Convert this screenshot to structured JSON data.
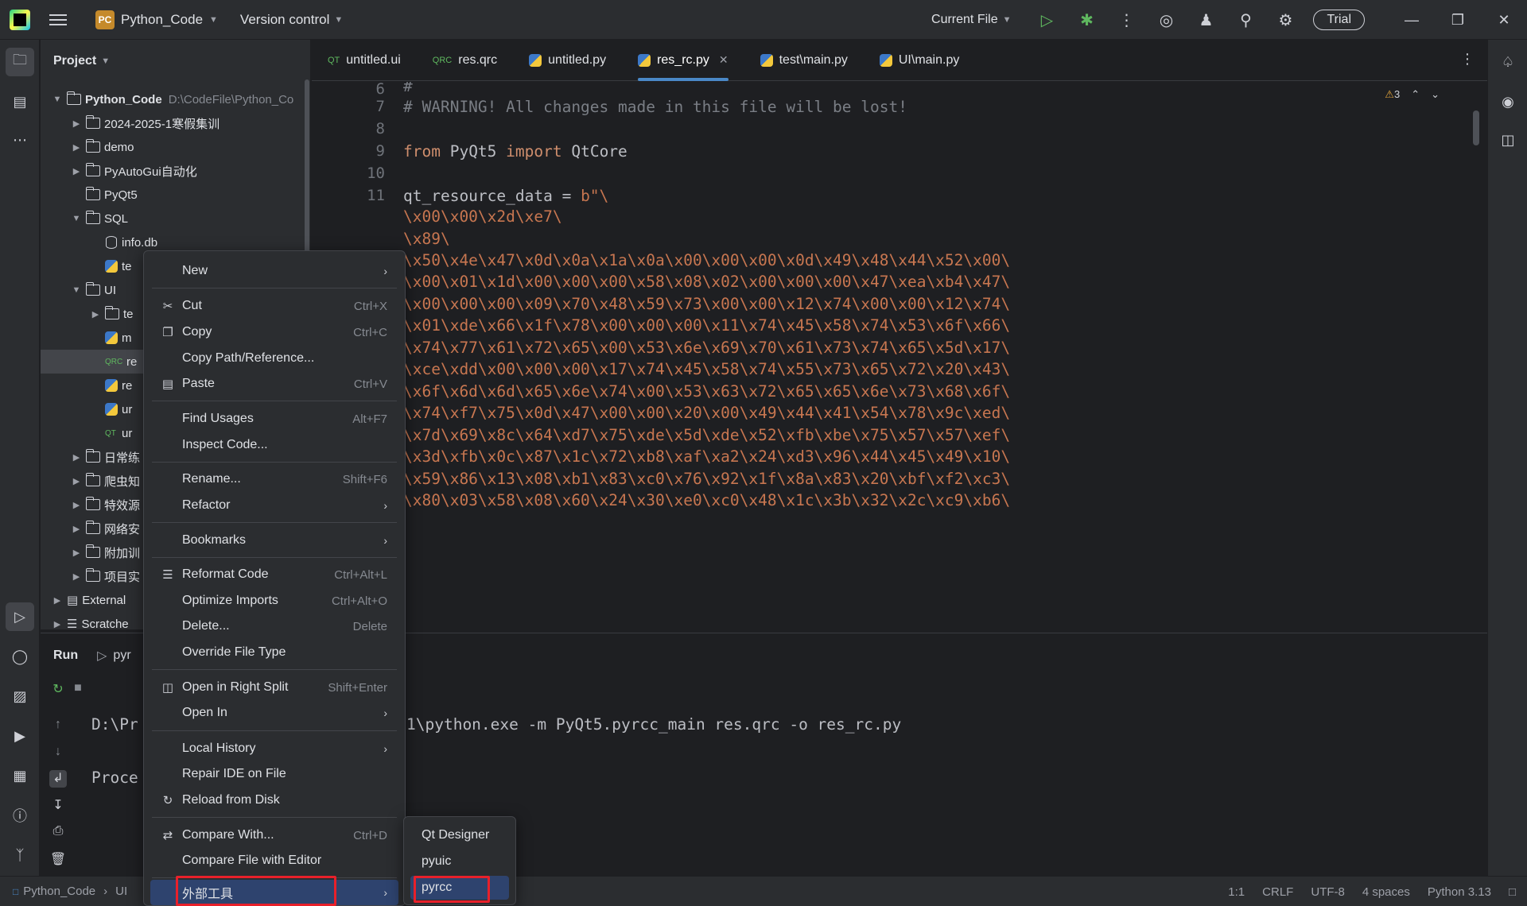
{
  "titlebar": {
    "project_badge": "PC",
    "project_name": "Python_Code",
    "vcs": "Version control",
    "run_config": "Current File",
    "trial": "Trial"
  },
  "project_panel": {
    "title": "Project",
    "root_name": "Python_Code",
    "root_path": "D:\\CodeFile\\Python_Co",
    "items": [
      {
        "label": "2024-2025-1寒假集训"
      },
      {
        "label": "demo"
      },
      {
        "label": "PyAutoGui自动化"
      },
      {
        "label": "PyQt5"
      },
      {
        "label": "SQL"
      },
      {
        "label": "info.db"
      },
      {
        "label": "te"
      },
      {
        "label": "UI"
      },
      {
        "label": "te"
      },
      {
        "label": "m"
      },
      {
        "label": "re"
      },
      {
        "label": "re"
      },
      {
        "label": "ur"
      },
      {
        "label": "ur"
      },
      {
        "label": "日常练"
      },
      {
        "label": "爬虫知"
      },
      {
        "label": "特效源"
      },
      {
        "label": "网络安"
      },
      {
        "label": "附加训"
      },
      {
        "label": "项目实"
      },
      {
        "label": "External"
      },
      {
        "label": "Scratche"
      }
    ]
  },
  "tabs": [
    {
      "label": "untitled.ui",
      "icon": "QT"
    },
    {
      "label": "res.qrc",
      "icon": "QRC"
    },
    {
      "label": "untitled.py",
      "icon": "py"
    },
    {
      "label": "res_rc.py",
      "icon": "py"
    },
    {
      "label": "test\\main.py",
      "icon": "py"
    },
    {
      "label": "UI\\main.py",
      "icon": "py"
    }
  ],
  "editor": {
    "warning_count": "3",
    "line_numbers": [
      "6",
      "7",
      "8",
      "9",
      "10",
      "11"
    ],
    "code": {
      "l6": "#",
      "l7": "# WARNING! All changes made in this file will be lost!",
      "l9_from": "from",
      "l9_mod": " PyQt5 ",
      "l9_import": "import",
      "l9_name": " QtCore",
      "l11_var": "qt_resource_data = ",
      "l11_str": "b\"\\",
      "data_lines": [
        "\\x00\\x00\\x2d\\xe7\\",
        "\\x89\\",
        "\\x50\\x4e\\x47\\x0d\\x0a\\x1a\\x0a\\x00\\x00\\x00\\x0d\\x49\\x48\\x44\\x52\\x00\\",
        "\\x00\\x01\\x1d\\x00\\x00\\x00\\x58\\x08\\x02\\x00\\x00\\x00\\x47\\xea\\xb4\\x47\\",
        "\\x00\\x00\\x00\\x09\\x70\\x48\\x59\\x73\\x00\\x00\\x12\\x74\\x00\\x00\\x12\\x74\\",
        "\\x01\\xde\\x66\\x1f\\x78\\x00\\x00\\x00\\x11\\x74\\x45\\x58\\x74\\x53\\x6f\\x66\\",
        "\\x74\\x77\\x61\\x72\\x65\\x00\\x53\\x6e\\x69\\x70\\x61\\x73\\x74\\x65\\x5d\\x17\\",
        "\\xce\\xdd\\x00\\x00\\x00\\x17\\x74\\x45\\x58\\x74\\x55\\x73\\x65\\x72\\x20\\x43\\",
        "\\x6f\\x6d\\x6d\\x65\\x6e\\x74\\x00\\x53\\x63\\x72\\x65\\x65\\x6e\\x73\\x68\\x6f\\",
        "\\x74\\xf7\\x75\\x0d\\x47\\x00\\x00\\x20\\x00\\x49\\x44\\x41\\x54\\x78\\x9c\\xed\\",
        "\\x7d\\x69\\x8c\\x64\\xd7\\x75\\xde\\x5d\\xde\\x52\\xfb\\xbe\\x75\\x57\\x57\\xef\\",
        "\\x3d\\xfb\\x0c\\x87\\x1c\\x72\\xb8\\xaf\\xa2\\x24\\xd3\\x96\\x44\\x45\\x49\\x10\\",
        "\\x59\\x86\\x13\\x08\\xb1\\x83\\xc0\\x76\\x92\\x1f\\x8a\\x83\\x20\\xbf\\xf2\\xc3\\",
        "\\x80\\x03\\x58\\x08\\x60\\x24\\x30\\xe0\\xc0\\x48\\x1c\\x3b\\x32\\x2c\\xc9\\xb6\\"
      ]
    }
  },
  "run_panel": {
    "title": "Run",
    "tab": "pyr",
    "console_line1_left": "D:\\Pr",
    "console_line1_right": "1\\python.exe -m PyQt5.pyrcc_main res.qrc -o res_rc.py",
    "console_line2": "Proce"
  },
  "context_menu": {
    "items": [
      {
        "label": "New",
        "shortcut": ""
      },
      {
        "label": "Cut",
        "shortcut": "Ctrl+X"
      },
      {
        "label": "Copy",
        "shortcut": "Ctrl+C"
      },
      {
        "label": "Copy Path/Reference...",
        "shortcut": ""
      },
      {
        "label": "Paste",
        "shortcut": "Ctrl+V"
      },
      {
        "label": "Find Usages",
        "shortcut": "Alt+F7"
      },
      {
        "label": "Inspect Code...",
        "shortcut": ""
      },
      {
        "label": "Rename...",
        "shortcut": "Shift+F6"
      },
      {
        "label": "Refactor",
        "shortcut": ""
      },
      {
        "label": "Bookmarks",
        "shortcut": ""
      },
      {
        "label": "Reformat Code",
        "shortcut": "Ctrl+Alt+L"
      },
      {
        "label": "Optimize Imports",
        "shortcut": "Ctrl+Alt+O"
      },
      {
        "label": "Delete...",
        "shortcut": "Delete"
      },
      {
        "label": "Override File Type",
        "shortcut": ""
      },
      {
        "label": "Open in Right Split",
        "shortcut": "Shift+Enter"
      },
      {
        "label": "Open In",
        "shortcut": ""
      },
      {
        "label": "Local History",
        "shortcut": ""
      },
      {
        "label": "Repair IDE on File",
        "shortcut": ""
      },
      {
        "label": "Reload from Disk",
        "shortcut": ""
      },
      {
        "label": "Compare With...",
        "shortcut": "Ctrl+D"
      },
      {
        "label": "Compare File with Editor",
        "shortcut": ""
      },
      {
        "label": "外部工具",
        "shortcut": ""
      }
    ]
  },
  "submenu": {
    "items": [
      {
        "label": "Qt Designer"
      },
      {
        "label": "pyuic"
      },
      {
        "label": "pyrcc"
      }
    ]
  },
  "statusbar": {
    "crumb_project": "Python_Code",
    "crumb_folder": "UI",
    "position": "1:1",
    "line_sep": "CRLF",
    "encoding": "UTF-8",
    "indent": "4 spaces",
    "interpreter": "Python 3.13"
  },
  "colors": {
    "accent": "#2e436e",
    "highlight_box": "#e8202a",
    "string": "#c77650",
    "keyword": "#cf8e6d"
  }
}
